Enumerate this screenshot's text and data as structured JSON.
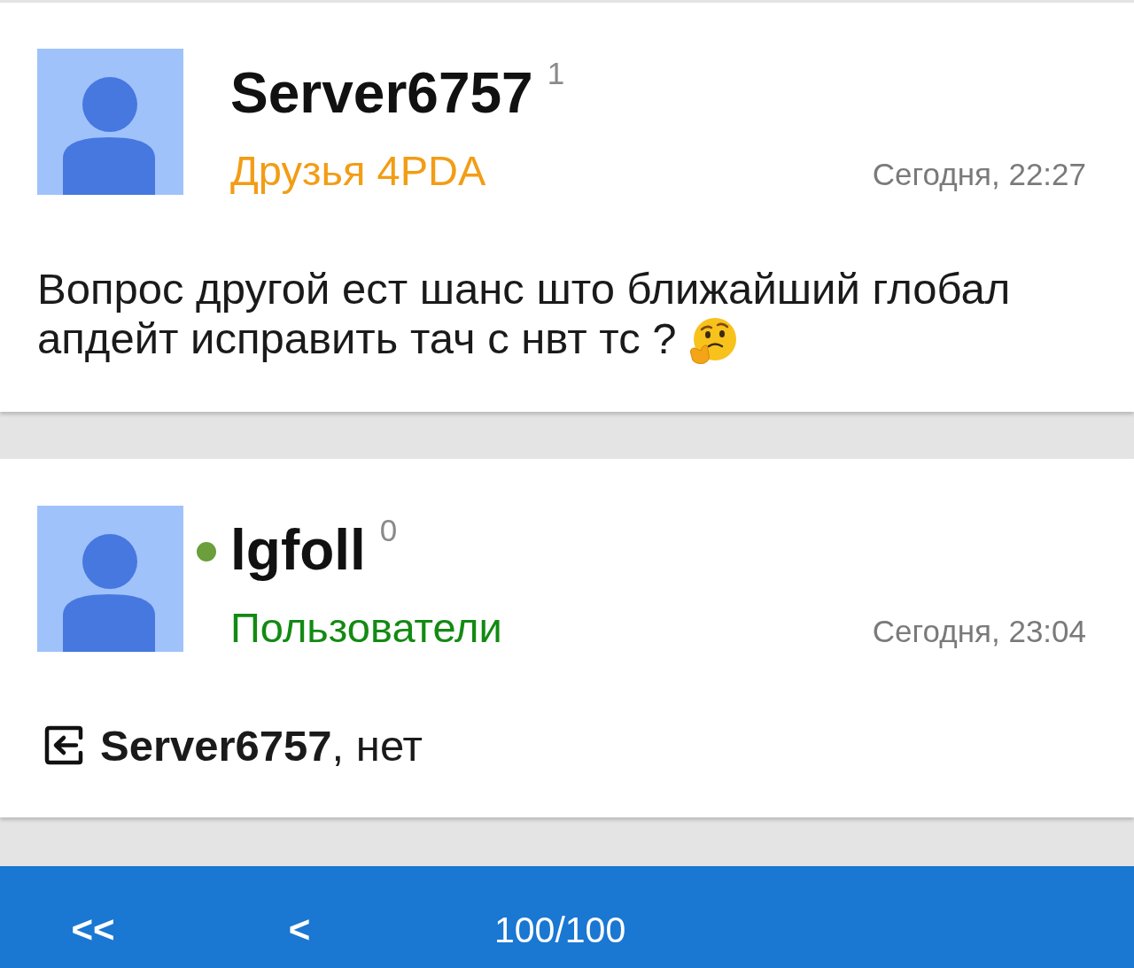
{
  "posts": [
    {
      "author": {
        "name": "Server6757",
        "reputation": "1",
        "online": false,
        "group": {
          "label": "Друзья 4PDA",
          "color": "#f29d15"
        }
      },
      "time": "Сегодня, 22:27",
      "body": [
        {
          "kind": "text",
          "text": "Вопрос другой ест шанс што ближайший глобал"
        },
        {
          "kind": "text",
          "text": "апдейт исправить тач с нвт тс ?"
        },
        {
          "kind": "emoji"
        }
      ]
    },
    {
      "author": {
        "name": "lgfoll",
        "reputation": "0",
        "online": true,
        "group": {
          "label": "Пользователи",
          "color": "#138a13"
        }
      },
      "time": "Сегодня, 23:04",
      "body": [
        {
          "kind": "quote_icon"
        },
        {
          "kind": "text",
          "text": "**Server6757**, нет"
        }
      ]
    }
  ],
  "pager": {
    "buttons": [
      {
        "label": "<<"
      },
      {
        "label": "<"
      }
    ],
    "page": "100/100"
  }
}
